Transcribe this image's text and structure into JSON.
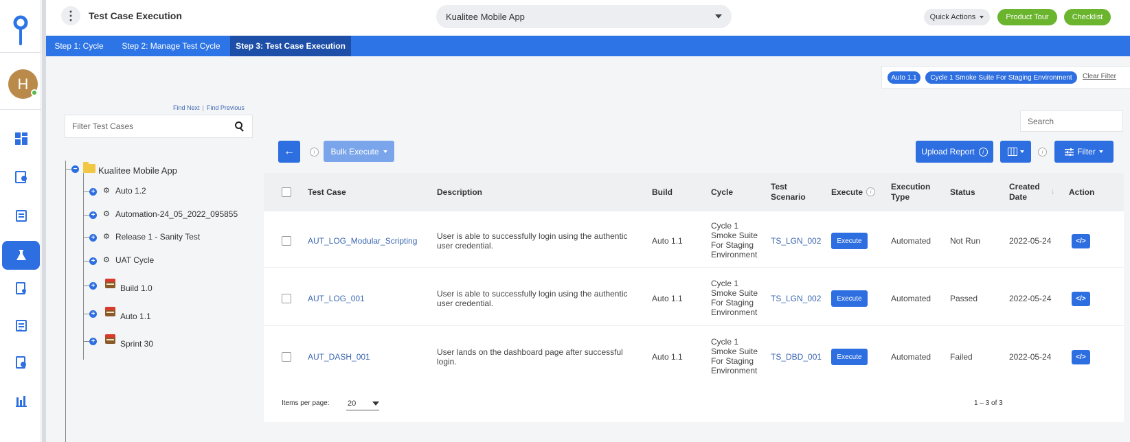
{
  "header": {
    "title": "Test Case Execution",
    "project": "Kualitee Mobile App",
    "quick_actions": "Quick Actions",
    "product_tour": "Product Tour",
    "checklist": "Checklist"
  },
  "user": {
    "initial": "H"
  },
  "steps": [
    {
      "label": "Step 1: Cycle"
    },
    {
      "label": "Step 2: Manage Test Cycle"
    },
    {
      "label": "Step 3: Test Case Execution"
    }
  ],
  "filters": {
    "chips": [
      "Auto 1.1",
      "Cycle 1 Smoke Suite For Staging Environment"
    ],
    "clear": "Clear Filter"
  },
  "tree": {
    "find_next": "Find Next",
    "find_previous": "Find Previous",
    "filter_placeholder": "Filter Test Cases",
    "root": "Kualitee Mobile App",
    "children": [
      {
        "label": "Auto 1.2",
        "icon": "gears-icon"
      },
      {
        "label": "Automation-24_05_2022_095855",
        "icon": "gears-icon"
      },
      {
        "label": "Release 1 - Sanity Test",
        "icon": "gears-icon"
      },
      {
        "label": "UAT Cycle",
        "icon": "gears-icon"
      },
      {
        "label": "Build 1.0",
        "icon": "box-icon"
      },
      {
        "label": "Auto 1.1",
        "icon": "box-icon"
      },
      {
        "label": "Sprint 30",
        "icon": "box-icon"
      }
    ]
  },
  "toolbar": {
    "search_placeholder": "Search",
    "bulk_execute": "Bulk Execute",
    "upload_report": "Upload Report",
    "filter": "Filter"
  },
  "table": {
    "headers": {
      "test_case": "Test Case",
      "description": "Description",
      "build": "Build",
      "cycle": "Cycle",
      "test_scenario_1": "Test",
      "test_scenario_2": "Scenario",
      "execute": "Execute",
      "execution_type_1": "Execution",
      "execution_type_2": "Type",
      "status": "Status",
      "created_1": "Created",
      "created_2": "Date",
      "action": "Action"
    },
    "rows": [
      {
        "test_case": "AUT_LOG_Modular_Scripting",
        "desc1": "User is able to successfully login using the authentic",
        "desc2": "user credential.",
        "build": "Auto 1.1",
        "cycle1": "Cycle 1",
        "cycle2": "Smoke Suite",
        "cycle3": "For Staging",
        "cycle4": "Environment",
        "scenario": "TS_LGN_002",
        "execute": "Execute",
        "type": "Automated",
        "status": "Not Run",
        "date": "2022-05-24",
        "action": "</>"
      },
      {
        "test_case": "AUT_LOG_001",
        "desc1": "User is able to successfully login using the authentic",
        "desc2": "user credential.",
        "build": "Auto 1.1",
        "cycle1": "Cycle 1",
        "cycle2": "Smoke Suite",
        "cycle3": "For Staging",
        "cycle4": "Environment",
        "scenario": "TS_LGN_002",
        "execute": "Execute",
        "type": "Automated",
        "status": "Passed",
        "date": "2022-05-24",
        "action": "</>"
      },
      {
        "test_case": "AUT_DASH_001",
        "desc1": "User lands on the dashboard page after successful",
        "desc2": "login.",
        "build": "Auto 1.1",
        "cycle1": "Cycle 1",
        "cycle2": "Smoke Suite",
        "cycle3": "For Staging",
        "cycle4": "Environment",
        "scenario": "TS_DBD_001",
        "execute": "Execute",
        "type": "Automated",
        "status": "Failed",
        "date": "2022-05-24",
        "action": "</>"
      }
    ]
  },
  "pager": {
    "label": "Items per page:",
    "value": "20",
    "range": "1 – 3 of 3"
  },
  "colors": {
    "primary": "#2d6ee0",
    "steps_bar": "#2d74e6",
    "step_active": "#1d4fa8",
    "green": "#6ab42e"
  }
}
